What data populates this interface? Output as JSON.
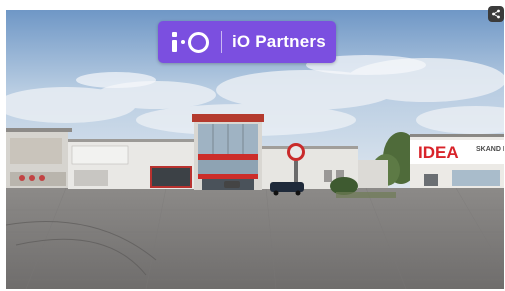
{
  "badge": {
    "brand_name": "iO Partners",
    "logo_icon": "io-logo-icon",
    "color": "#7b4fe0"
  },
  "share": {
    "icon": "share-icon"
  },
  "storefront": {
    "sign_text": "IDEA",
    "sign_text_partial": "SKAND NÁB",
    "sign_color": "#d8232a"
  }
}
